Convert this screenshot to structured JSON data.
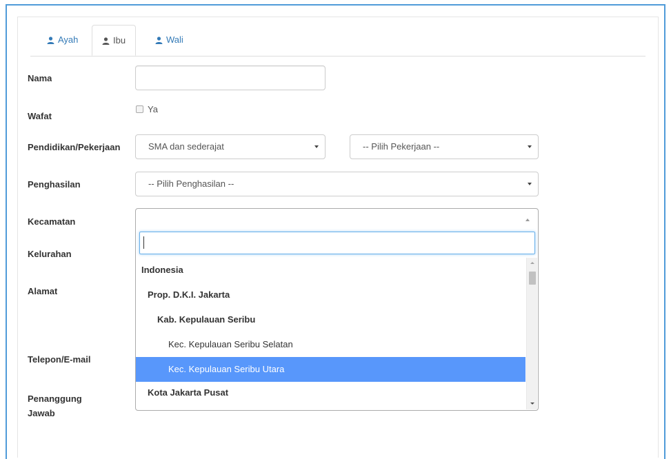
{
  "tabs": [
    {
      "label": "Ayah",
      "icon": "user-icon",
      "active": false
    },
    {
      "label": "Ibu",
      "icon": "user-icon",
      "active": true
    },
    {
      "label": "Wali",
      "icon": "user-icon",
      "active": false
    }
  ],
  "form": {
    "nama": {
      "label": "Nama",
      "value": ""
    },
    "wafat": {
      "label": "Wafat",
      "checkbox_label": "Ya",
      "checked": false
    },
    "pendidikan": {
      "label": "Pendidikan/Pekerjaan",
      "value": "SMA dan sederajat",
      "pekerjaan_value": "-- Pilih Pekerjaan --"
    },
    "penghasilan": {
      "label": "Penghasilan",
      "value": "-- Pilih Penghasilan --"
    },
    "kecamatan": {
      "label": "Kecamatan",
      "value": ""
    },
    "kelurahan": {
      "label": "Kelurahan"
    },
    "alamat": {
      "label": "Alamat"
    },
    "telepon": {
      "label": "Telepon/E-mail"
    },
    "penanggung": {
      "label": "Penanggung Jawab"
    }
  },
  "dropdown": {
    "search_value": "",
    "options": [
      {
        "label": "Indonesia",
        "level": 0,
        "group": true,
        "selected": false
      },
      {
        "label": "Prop. D.K.I. Jakarta",
        "level": 1,
        "group": true,
        "selected": false
      },
      {
        "label": "Kab. Kepulauan Seribu",
        "level": 2,
        "group": true,
        "selected": false
      },
      {
        "label": "Kec. Kepulauan Seribu Selatan",
        "level": 3,
        "group": false,
        "selected": false
      },
      {
        "label": "Kec. Kepulauan Seribu Utara",
        "level": 3,
        "group": false,
        "selected": true
      },
      {
        "label": "Kota Jakarta Pusat",
        "level": 1,
        "group": true,
        "selected": false
      }
    ]
  },
  "colors": {
    "link": "#337ab7",
    "highlight": "#5897fb",
    "frame_border": "#4f9bd9",
    "focus": "#66afe9"
  }
}
